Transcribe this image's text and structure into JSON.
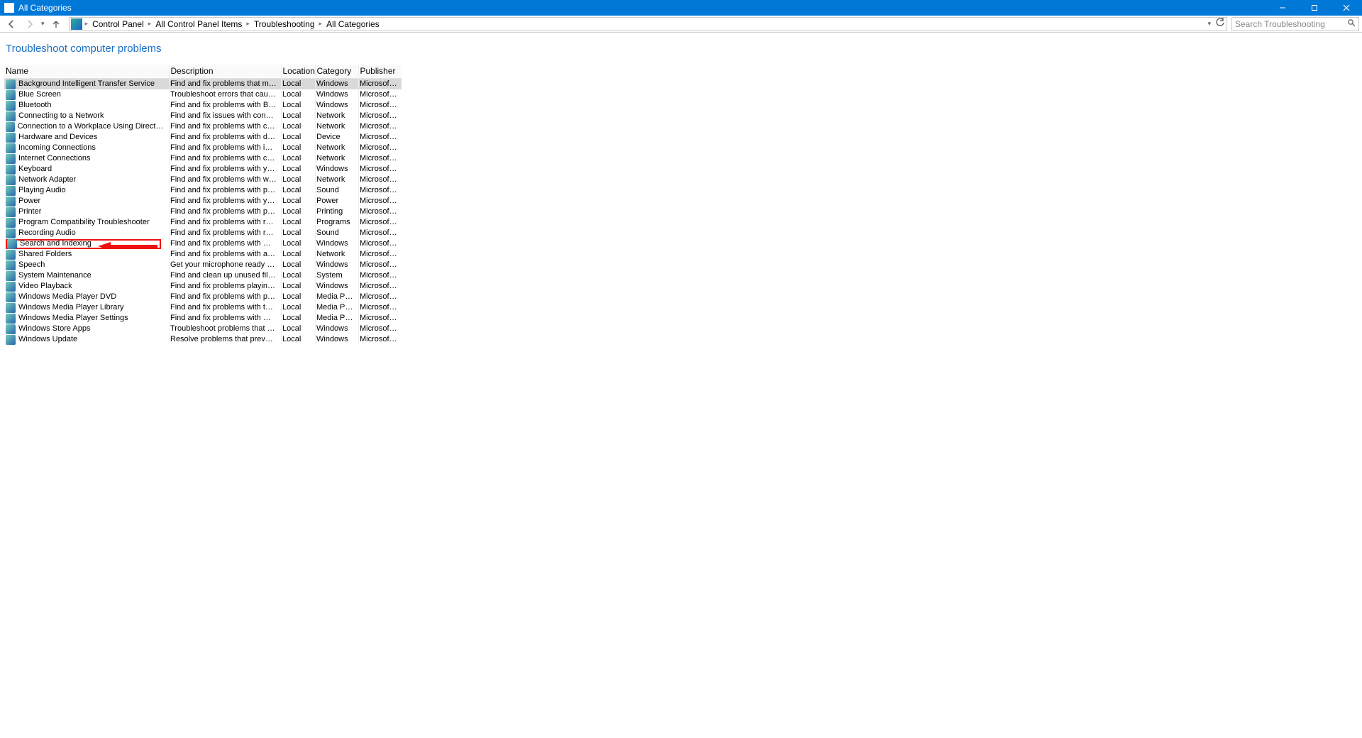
{
  "window": {
    "title": "All Categories"
  },
  "breadcrumb": {
    "items": [
      "Control Panel",
      "All Control Panel Items",
      "Troubleshooting",
      "All Categories"
    ]
  },
  "search": {
    "placeholder": "Search Troubleshooting"
  },
  "page_title": "Troubleshoot computer problems",
  "columns": {
    "name": "Name",
    "description": "Description",
    "location": "Location",
    "category": "Category",
    "publisher": "Publisher"
  },
  "rows": [
    {
      "name": "Background Intelligent Transfer Service",
      "desc": "Find and fix problems that may p...",
      "loc": "Local",
      "cat": "Windows",
      "pub": "Microsoft ...",
      "active": true
    },
    {
      "name": "Blue Screen",
      "desc": "Troubleshoot errors that cause Wi...",
      "loc": "Local",
      "cat": "Windows",
      "pub": "Microsoft ..."
    },
    {
      "name": "Bluetooth",
      "desc": "Find and fix problems with Blueto...",
      "loc": "Local",
      "cat": "Windows",
      "pub": "Microsoft ..."
    },
    {
      "name": "Connecting to a Network",
      "desc": "Find and fix issues with connecti...",
      "loc": "Local",
      "cat": "Network",
      "pub": "Microsoft ..."
    },
    {
      "name": "Connection to a Workplace Using DirectAccess",
      "desc": "Find and fix problems with conne...",
      "loc": "Local",
      "cat": "Network",
      "pub": "Microsoft ..."
    },
    {
      "name": "Hardware and Devices",
      "desc": "Find and fix problems with device...",
      "loc": "Local",
      "cat": "Device",
      "pub": "Microsoft ..."
    },
    {
      "name": "Incoming Connections",
      "desc": "Find and fix problems with incom...",
      "loc": "Local",
      "cat": "Network",
      "pub": "Microsoft ..."
    },
    {
      "name": "Internet Connections",
      "desc": "Find and fix problems with conne...",
      "loc": "Local",
      "cat": "Network",
      "pub": "Microsoft ..."
    },
    {
      "name": "Keyboard",
      "desc": "Find and fix problems with your c...",
      "loc": "Local",
      "cat": "Windows",
      "pub": "Microsoft ..."
    },
    {
      "name": "Network Adapter",
      "desc": "Find and fix problems with wirele...",
      "loc": "Local",
      "cat": "Network",
      "pub": "Microsoft ..."
    },
    {
      "name": "Playing Audio",
      "desc": "Find and fix problems with playin...",
      "loc": "Local",
      "cat": "Sound",
      "pub": "Microsoft ..."
    },
    {
      "name": "Power",
      "desc": "Find and fix problems with your c...",
      "loc": "Local",
      "cat": "Power",
      "pub": "Microsoft ..."
    },
    {
      "name": "Printer",
      "desc": "Find and fix problems with printi...",
      "loc": "Local",
      "cat": "Printing",
      "pub": "Microsoft ..."
    },
    {
      "name": "Program Compatibility Troubleshooter",
      "desc": "Find and fix problems with runni...",
      "loc": "Local",
      "cat": "Programs",
      "pub": "Microsoft ..."
    },
    {
      "name": "Recording Audio",
      "desc": "Find and fix problems with record...",
      "loc": "Local",
      "cat": "Sound",
      "pub": "Microsoft ..."
    },
    {
      "name": "Search and Indexing",
      "desc": "Find and fix problems with Wind...",
      "loc": "Local",
      "cat": "Windows",
      "pub": "Microsoft ...",
      "highlight": true
    },
    {
      "name": "Shared Folders",
      "desc": "Find and fix problems with access...",
      "loc": "Local",
      "cat": "Network",
      "pub": "Microsoft ..."
    },
    {
      "name": "Speech",
      "desc": "Get your microphone ready and f...",
      "loc": "Local",
      "cat": "Windows",
      "pub": "Microsoft ..."
    },
    {
      "name": "System Maintenance",
      "desc": "Find and clean up unused files an...",
      "loc": "Local",
      "cat": "System",
      "pub": "Microsoft ..."
    },
    {
      "name": "Video Playback",
      "desc": "Find and fix problems playing mo...",
      "loc": "Local",
      "cat": "Windows",
      "pub": "Microsoft ..."
    },
    {
      "name": "Windows Media Player DVD",
      "desc": "Find and fix problems with playin...",
      "loc": "Local",
      "cat": "Media Pla...",
      "pub": "Microsoft ..."
    },
    {
      "name": "Windows Media Player Library",
      "desc": "Find and fix problems with the Wi...",
      "loc": "Local",
      "cat": "Media Pla...",
      "pub": "Microsoft ..."
    },
    {
      "name": "Windows Media Player Settings",
      "desc": "Find and fix problems with Wind...",
      "loc": "Local",
      "cat": "Media Pla...",
      "pub": "Microsoft ..."
    },
    {
      "name": "Windows Store Apps",
      "desc": "Troubleshoot problems that may ...",
      "loc": "Local",
      "cat": "Windows",
      "pub": "Microsoft ..."
    },
    {
      "name": "Windows Update",
      "desc": "Resolve problems that prevent yo...",
      "loc": "Local",
      "cat": "Windows",
      "pub": "Microsoft ..."
    }
  ]
}
